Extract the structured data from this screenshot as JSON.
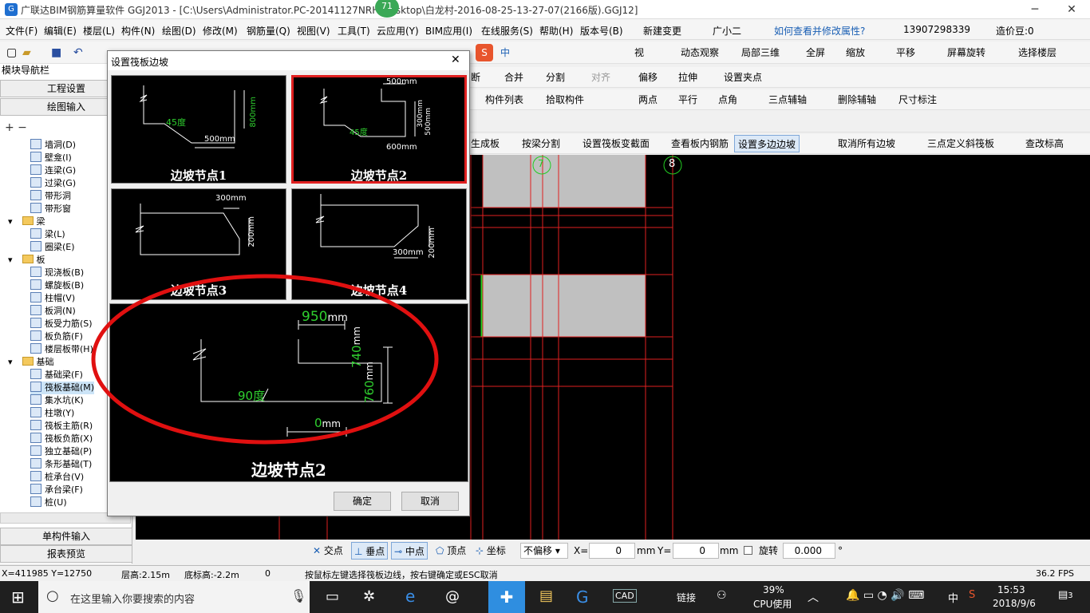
{
  "window": {
    "title": "广联达BIM钢筋算量软件 GGJ2013 - [C:\\Users\\Administrator.PC-20141127NRH\\Desktop\\白龙村-2016-08-25-13-27-07(2166版).GGJ12]",
    "badge": "71",
    "min": "─",
    "max": "❐",
    "close": "✕"
  },
  "menu": [
    "文件(F)",
    "编辑(E)",
    "楼层(L)",
    "构件(N)",
    "绘图(D)",
    "修改(M)",
    "钢筋量(Q)",
    "视图(V)",
    "工具(T)",
    "云应用(Y)",
    "BIM应用(I)",
    "在线服务(S)",
    "帮助(H)",
    "版本号(B)",
    "新建变更",
    "广小二"
  ],
  "menu_right": {
    "help_link": "如何查看并修改属性?",
    "phone": "13907298339",
    "price": "造价豆:0"
  },
  "toolbar1": {
    "view": "视",
    "dynamic": "动态观察",
    "local3d": "局部三维",
    "fullscreen": "全屏",
    "zoom": "缩放",
    "pan": "平移",
    "rotate": "屏幕旋转",
    "select_floor": "选择楼层"
  },
  "toolbar2": {
    "break": "断",
    "merge": "合并",
    "split": "分割",
    "align": "对齐",
    "offset": "偏移",
    "stretch": "拉伸",
    "setpoint": "设置夹点"
  },
  "toolbar3": {
    "list": "构件列表",
    "pick": "拾取构件",
    "twopoint": "两点",
    "parallel": "平行",
    "pointangle": "点角",
    "threeaux": "三点辅轴",
    "delaux": "删除辅轴",
    "dimension": "尺寸标注"
  },
  "toolbar4": {
    "gen": "生成板",
    "beamsplit": "按梁分割",
    "setsection": "设置筏板变截面",
    "viewrebar": "查看板内钢筋",
    "multislope": "设置多边边坡",
    "cancelslope": "取消所有边坡",
    "threepoint": "三点定义斜筏板",
    "elevation": "查改标高"
  },
  "nav": {
    "title": "模块导航栏",
    "project": "工程设置",
    "drawing": "绘图输入",
    "single": "单构件输入",
    "report": "报表预览",
    "items1": [
      "墙洞(D)",
      "壁龛(I)",
      "连梁(G)",
      "过梁(G)",
      "带形洞",
      "带形窗"
    ],
    "folder_beam": "梁",
    "items_beam": [
      "梁(L)",
      "圈梁(E)"
    ],
    "folder_slab": "板",
    "items_slab": [
      "现浇板(B)",
      "螺旋板(B)",
      "柱帽(V)",
      "板洞(N)",
      "板受力筋(S)",
      "板负筋(F)",
      "楼层板带(H)"
    ],
    "folder_found": "基础",
    "items_found": [
      "基础梁(F)",
      "筏板基础(M)",
      "集水坑(K)",
      "柱墩(Y)",
      "筏板主筋(R)",
      "筏板负筋(X)",
      "独立基础(P)",
      "条形基础(T)",
      "桩承台(V)",
      "承台梁(F)",
      "桩(U)"
    ]
  },
  "canvas": {
    "axis7": "7",
    "axis8": "8"
  },
  "dialog": {
    "title": "设置筏板边坡",
    "close": "✕",
    "panels": [
      {
        "label": "边坡节点1",
        "dim_a": "800",
        "unit_a": "mm",
        "angle": "45度",
        "dim_b": "500",
        "unit_b": "mm"
      },
      {
        "label": "边坡节点2",
        "dim_top": "500",
        "unit_top": "mm",
        "dim_r1": "300",
        "unit_r1": "mm",
        "dim_r2": "500",
        "unit_r2": "mm",
        "angle": "45度",
        "dim_b": "600",
        "unit_b": "mm"
      },
      {
        "label": "边坡节点3",
        "dim_top": "300",
        "unit_top": "mm",
        "dim_r": "200",
        "unit_r": "mm"
      },
      {
        "label": "边坡节点4",
        "dim_b": "300",
        "unit_b": "mm",
        "dim_r": "200",
        "unit_r": "mm"
      }
    ],
    "preview": {
      "label": "边坡节点2",
      "dim_top": "950",
      "unit_top": "mm",
      "dim_r1": "740",
      "unit_r1": "mm",
      "dim_r2": "760",
      "unit_r2": "mm",
      "angle": "90度",
      "dim_b": "0",
      "unit_b": "mm"
    },
    "ok": "确定",
    "cancel": "取消"
  },
  "snapbar": {
    "intersect": "交点",
    "perp": "垂点",
    "mid": "中点",
    "vertex": "顶点",
    "coord": "坐标",
    "offset_mode": "不偏移",
    "x_label": "X=",
    "x_val": "0",
    "x_unit": "mm",
    "y_label": "Y=",
    "y_val": "0",
    "y_unit": "mm",
    "rotate_label": "旋转",
    "rotate_val": "0.000",
    "deg": "°"
  },
  "status": {
    "coords": "X=411985 Y=12750",
    "floor_h": "层高:2.15m",
    "bottom_h": "底标高:-2.2m",
    "zero": "0",
    "hint": "按鼠标左键选择筏板边线，按右键确定或ESC取消",
    "fps": "36.2 FPS"
  },
  "taskbar": {
    "search": "在这里输入你要搜索的内容",
    "link": "链接",
    "cpu_pct": "39%",
    "cpu_label": "CPU使用",
    "lang": "中",
    "time": "15:53",
    "date": "2018/9/6",
    "notif": "3"
  }
}
